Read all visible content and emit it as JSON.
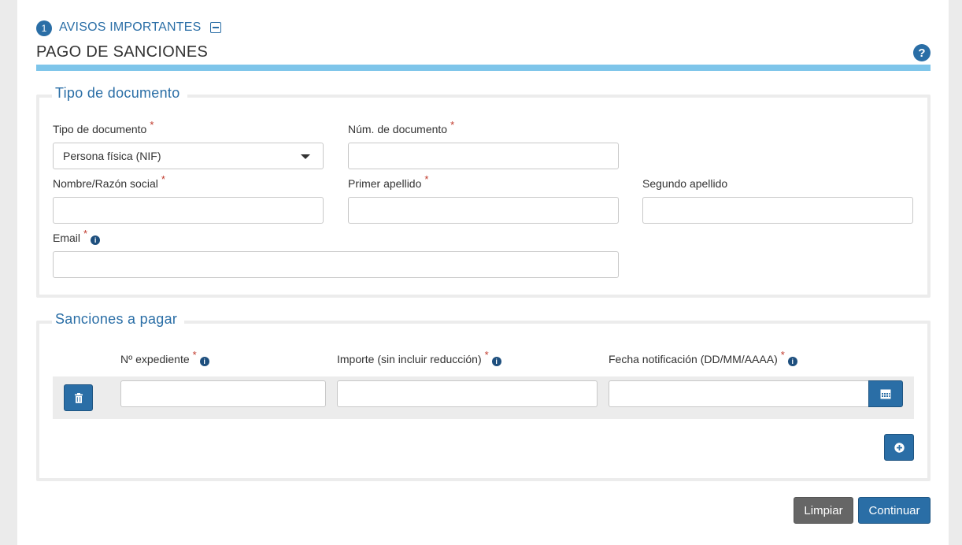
{
  "notice": {
    "number": "1",
    "label": "AVISOS IMPORTANTES"
  },
  "page_title": "PAGO DE SANCIONES",
  "help_glyph": "?",
  "document_section": {
    "legend": "Tipo de documento",
    "doc_type": {
      "label": "Tipo de documento",
      "required": "*",
      "selected": "Persona física (NIF)"
    },
    "doc_number": {
      "label": "Núm. de documento",
      "required": "*",
      "value": ""
    },
    "name": {
      "label": "Nombre/Razón social",
      "required": "*",
      "value": ""
    },
    "first_surname": {
      "label": "Primer apellido",
      "required": "*",
      "value": ""
    },
    "second_surname": {
      "label": "Segundo apellido",
      "value": ""
    },
    "email": {
      "label": "Email",
      "required": "*",
      "value": ""
    }
  },
  "sanctions_section": {
    "legend": "Sanciones a pagar",
    "columns": {
      "expediente": {
        "label": "Nº expediente",
        "required": "*"
      },
      "importe": {
        "label": "Importe (sin incluir reducción)",
        "required": "*"
      },
      "fecha": {
        "label": "Fecha notificación (DD/MM/AAAA)",
        "required": "*"
      }
    },
    "rows": [
      {
        "expediente": "",
        "importe": "",
        "fecha": ""
      }
    ]
  },
  "actions": {
    "clear": "Limpiar",
    "continue": "Continuar"
  },
  "icons": {
    "info": "info-icon",
    "help": "question-circle-icon",
    "collapse": "minus-square-icon",
    "delete": "trash-icon",
    "calendar": "calendar-icon",
    "add": "plus-circle-icon",
    "dropdown": "caret-down-icon"
  },
  "colors": {
    "accent": "#2a6ea6",
    "title_bar": "#7ec5ea",
    "required": "#c0392b",
    "clear_button": "#666666"
  }
}
